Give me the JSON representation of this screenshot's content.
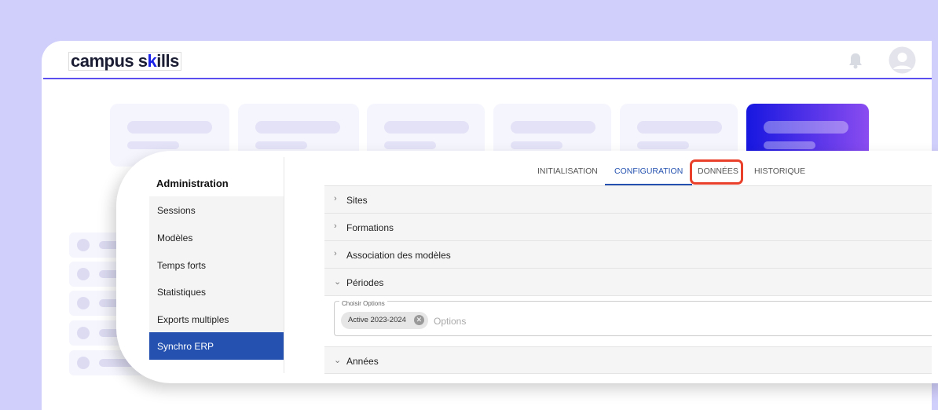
{
  "header": {
    "logo_text": "campus skills",
    "logo_part1": "campus s",
    "logo_k": "k",
    "logo_part2": "ills"
  },
  "sidebar": {
    "title": "Administration",
    "items": [
      {
        "label": "Sessions"
      },
      {
        "label": "Modèles"
      },
      {
        "label": "Temps forts"
      },
      {
        "label": "Statistiques"
      },
      {
        "label": "Exports multiples"
      },
      {
        "label": "Synchro ERP",
        "active": true
      }
    ]
  },
  "tabs": [
    {
      "label": "INITIALISATION"
    },
    {
      "label": "CONFIGURATION",
      "active": true
    },
    {
      "label": "DONNÉES",
      "highlighted": true
    },
    {
      "label": "HISTORIQUE"
    }
  ],
  "accordion": [
    {
      "label": "Sites",
      "expanded": false
    },
    {
      "label": "Formations",
      "expanded": false
    },
    {
      "label": "Association des modèles",
      "expanded": false
    },
    {
      "label": "Périodes",
      "expanded": true
    },
    {
      "label": "Années",
      "expanded": true
    }
  ],
  "field": {
    "label": "Choisir Options",
    "chip": "Active 2023-2024",
    "placeholder": "Options"
  },
  "colors": {
    "accent": "#2552b0",
    "header_line": "#5b4ff0",
    "highlight": "#e8402a",
    "background": "#d0cefa"
  },
  "icons": {
    "bell": "bell-icon",
    "avatar": "user-avatar-icon",
    "collapsed": "chevron-right-icon",
    "expanded": "chevron-down-icon",
    "chip_remove": "close-circle-icon",
    "annotation": "curved-arrow-icon"
  }
}
